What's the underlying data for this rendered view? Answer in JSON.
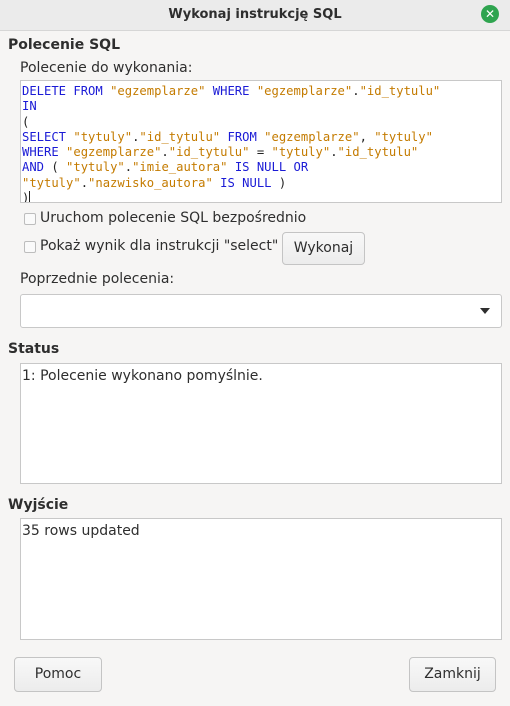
{
  "window": {
    "title": "Wykonaj instrukcję SQL",
    "close_symbol": "✕"
  },
  "sql_section": {
    "title": "Polecenie SQL",
    "command_label": "Polecenie do wykonania:",
    "query_lines": [
      [
        [
          "kw",
          "DELETE FROM "
        ],
        [
          "str",
          "\"egzemplarze\""
        ],
        [
          "kw",
          " WHERE "
        ],
        [
          "str",
          "\"egzemplarze\""
        ],
        [
          "txt",
          "."
        ],
        [
          "str",
          "\"id_tytulu\""
        ],
        [
          "txt",
          " "
        ]
      ],
      [
        [
          "kw",
          "IN"
        ]
      ],
      [
        [
          "txt",
          "("
        ]
      ],
      [
        [
          "kw",
          "SELECT "
        ],
        [
          "str",
          "\"tytuly\""
        ],
        [
          "txt",
          "."
        ],
        [
          "str",
          "\"id_tytulu\""
        ],
        [
          "kw",
          " FROM "
        ],
        [
          "str",
          "\"egzemplarze\""
        ],
        [
          "txt",
          ", "
        ],
        [
          "str",
          "\"tytuly\""
        ]
      ],
      [
        [
          "kw",
          "WHERE "
        ],
        [
          "str",
          "\"egzemplarze\""
        ],
        [
          "txt",
          "."
        ],
        [
          "str",
          "\"id_tytulu\""
        ],
        [
          "txt",
          " = "
        ],
        [
          "str",
          "\"tytuly\""
        ],
        [
          "txt",
          "."
        ],
        [
          "str",
          "\"id_tytulu\""
        ]
      ],
      [
        [
          "kw",
          "AND "
        ],
        [
          "txt",
          "( "
        ],
        [
          "str",
          "\"tytuly\""
        ],
        [
          "txt",
          "."
        ],
        [
          "str",
          "\"imie_autora\""
        ],
        [
          "kw",
          " IS NULL OR"
        ]
      ],
      [
        [
          "str",
          "\"tytuly\""
        ],
        [
          "txt",
          "."
        ],
        [
          "str",
          "\"nazwisko_autora\""
        ],
        [
          "kw",
          " IS NULL "
        ],
        [
          "txt",
          ")"
        ]
      ],
      [
        [
          "txt",
          ")"
        ]
      ]
    ],
    "run_direct_label": "Uruchom polecenie SQL bezpośrednio",
    "show_result_label": "Pokaż wynik dla instrukcji \"select\"",
    "execute_button": "Wykonaj",
    "previous_label": "Poprzednie polecenia:",
    "previous_value": ""
  },
  "status_section": {
    "title": "Status",
    "text": "1: Polecenie wykonano pomyślnie."
  },
  "output_section": {
    "title": "Wyjście",
    "text": "35 rows updated"
  },
  "footer": {
    "help_button": "Pomoc",
    "close_button": "Zamknij"
  }
}
